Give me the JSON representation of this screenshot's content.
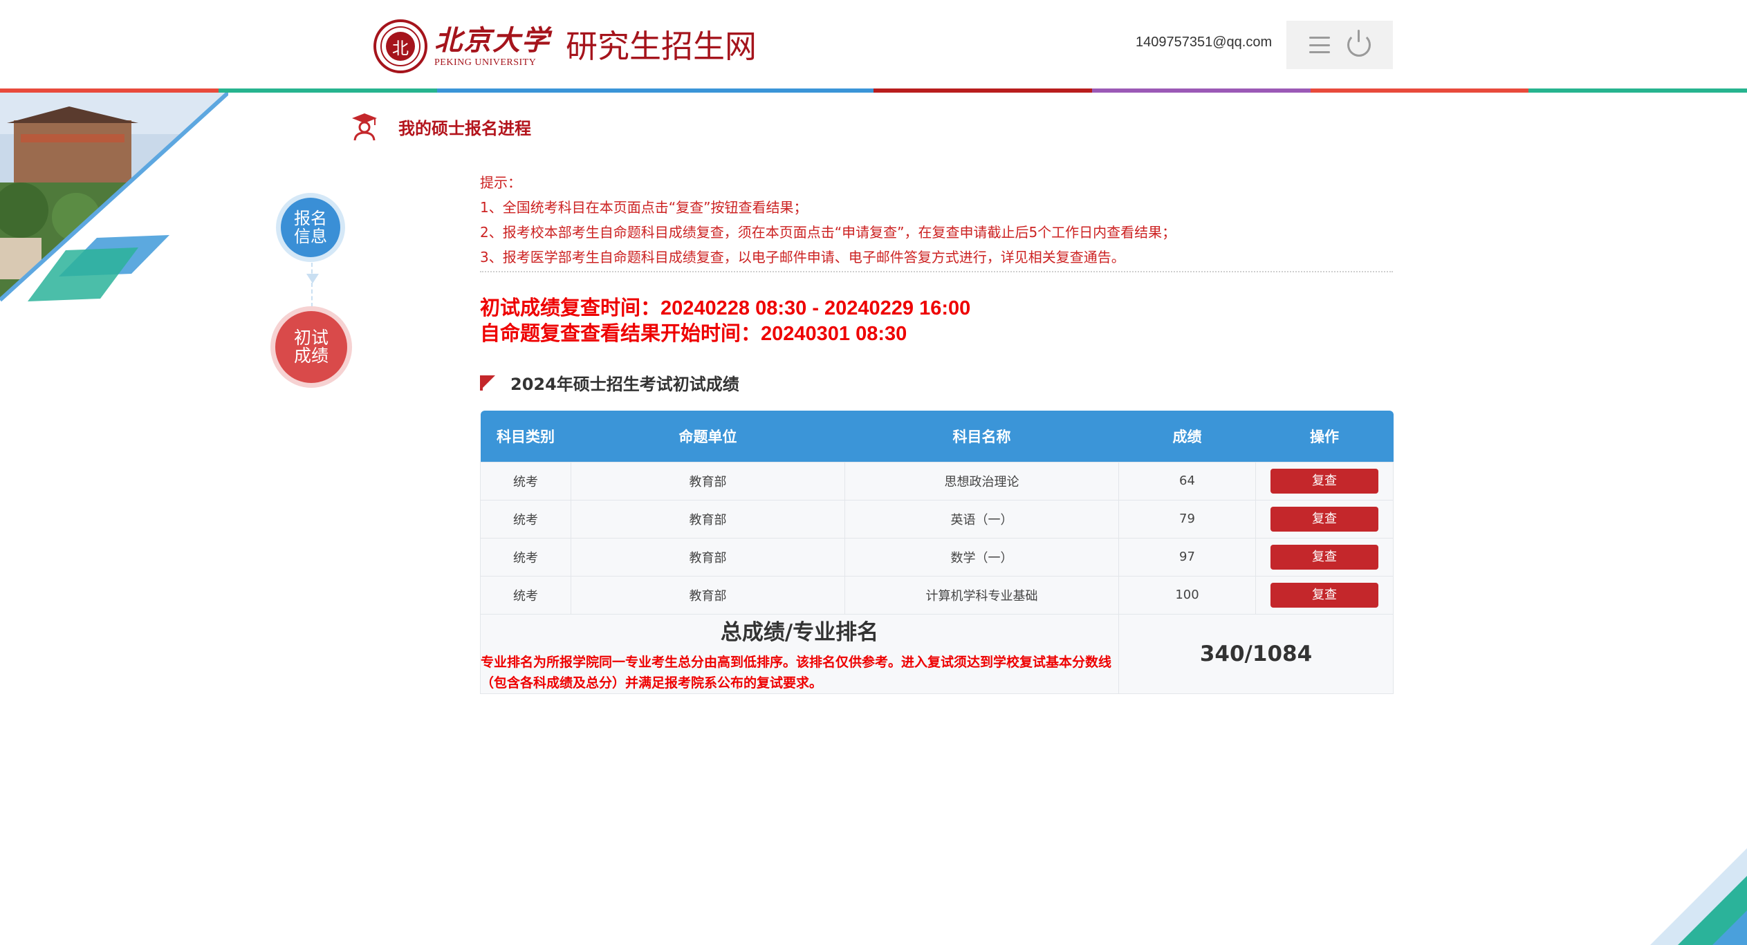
{
  "header": {
    "logo_seal": "北",
    "logo_cn": "北京大学",
    "logo_en": "PEKING UNIVERSITY",
    "site_title": "研究生招生网",
    "user_email": "1409757351@qq.com",
    "icons": [
      "menu-icon",
      "power-icon"
    ]
  },
  "strip_colors": [
    "#e84a3c",
    "#27b48f",
    "#3b95d8",
    "#3b95d8",
    "#b91d1d",
    "#9b59b6",
    "#e84a3c",
    "#27b48f"
  ],
  "page": {
    "title": "我的硕士报名进程"
  },
  "steps": [
    {
      "label": "报名\n信息",
      "color": "#3a8fd6"
    },
    {
      "label": "初试\n成绩",
      "color": "#d94a4a"
    }
  ],
  "notice": {
    "title": "提示：",
    "line1": "1、全国统考科目在本页面点击“复查”按钮查看结果；",
    "line2": "2、报考校本部考生自命题科目成绩复查，须在本页面点击“申请复查”，在复查申请截止后5个工作日内查看结果；",
    "line3": "3、报考医学部考生自命题科目成绩复查，以电子邮件申请、电子邮件答复方式进行，详见相关复查通告。"
  },
  "timing": {
    "line1": "初试成绩复查时间：20240228 08:30 - 20240229 16:00",
    "line2": "自命题复查查看结果开始时间：20240301 08:30"
  },
  "section": {
    "title": "2024年硕士招生考试初试成绩"
  },
  "table": {
    "headers": [
      "科目类别",
      "命题单位",
      "科目名称",
      "成绩",
      "操作"
    ],
    "rows": [
      {
        "category": "统考",
        "unit": "教育部",
        "subject": "思想政治理论",
        "score": "64",
        "action": "复查"
      },
      {
        "category": "统考",
        "unit": "教育部",
        "subject": "英语（一）",
        "score": "79",
        "action": "复查"
      },
      {
        "category": "统考",
        "unit": "教育部",
        "subject": "数学（一）",
        "score": "97",
        "action": "复查"
      },
      {
        "category": "统考",
        "unit": "教育部",
        "subject": "计算机学科专业基础",
        "score": "100",
        "action": "复查"
      }
    ],
    "total_label": "总成绩/专业排名",
    "total_note": "专业排名为所报学院同一专业考生总分由高到低排序。该排名仅供参考。进入复试须达到学校复试基本分数线（包含各科成绩及总分）并满足报考院系公布的复试要求。",
    "total_value": "340/1084"
  }
}
